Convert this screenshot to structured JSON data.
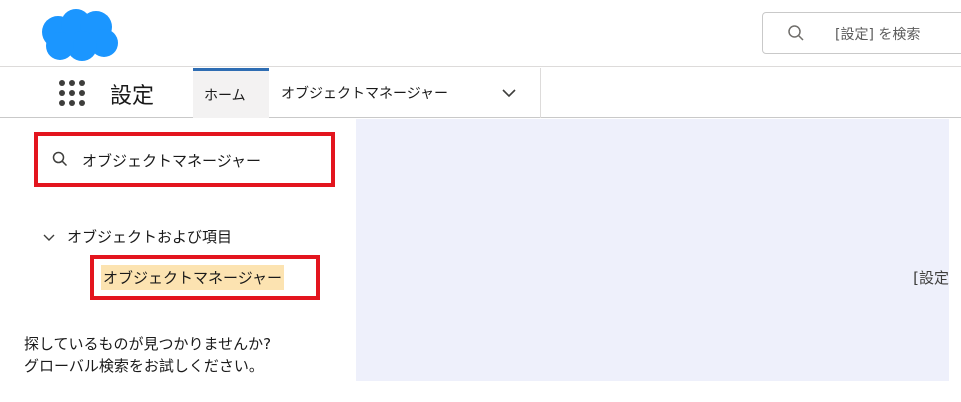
{
  "header": {
    "logo_icon": "salesforce-cloud-icon",
    "search_placeholder": "[設定] を検索"
  },
  "navbar": {
    "app_launcher_icon": "app-launcher-grid-icon",
    "app_title": "設定",
    "tabs": [
      {
        "label": "ホーム",
        "active": true
      },
      {
        "label": "オブジェクトマネージャー",
        "icon": "chevron-down-icon"
      }
    ]
  },
  "sidebar": {
    "quickfind_value": "オブジェクトマネージャー",
    "section_label": "オブジェクトおよび項目",
    "section_item": "オブジェクトマネージャー",
    "help_line1": "探しているものが見つかりませんか?",
    "help_line2": "グローバル検索をお試しください。"
  },
  "main": {
    "text": "[設定"
  },
  "colors": {
    "brand_blue": "#1b96ff",
    "active_tab_border": "#2e6db3",
    "highlight_box": "#e3151e",
    "search_highlight": "#fce3b1",
    "main_background": "#eef0fb"
  }
}
